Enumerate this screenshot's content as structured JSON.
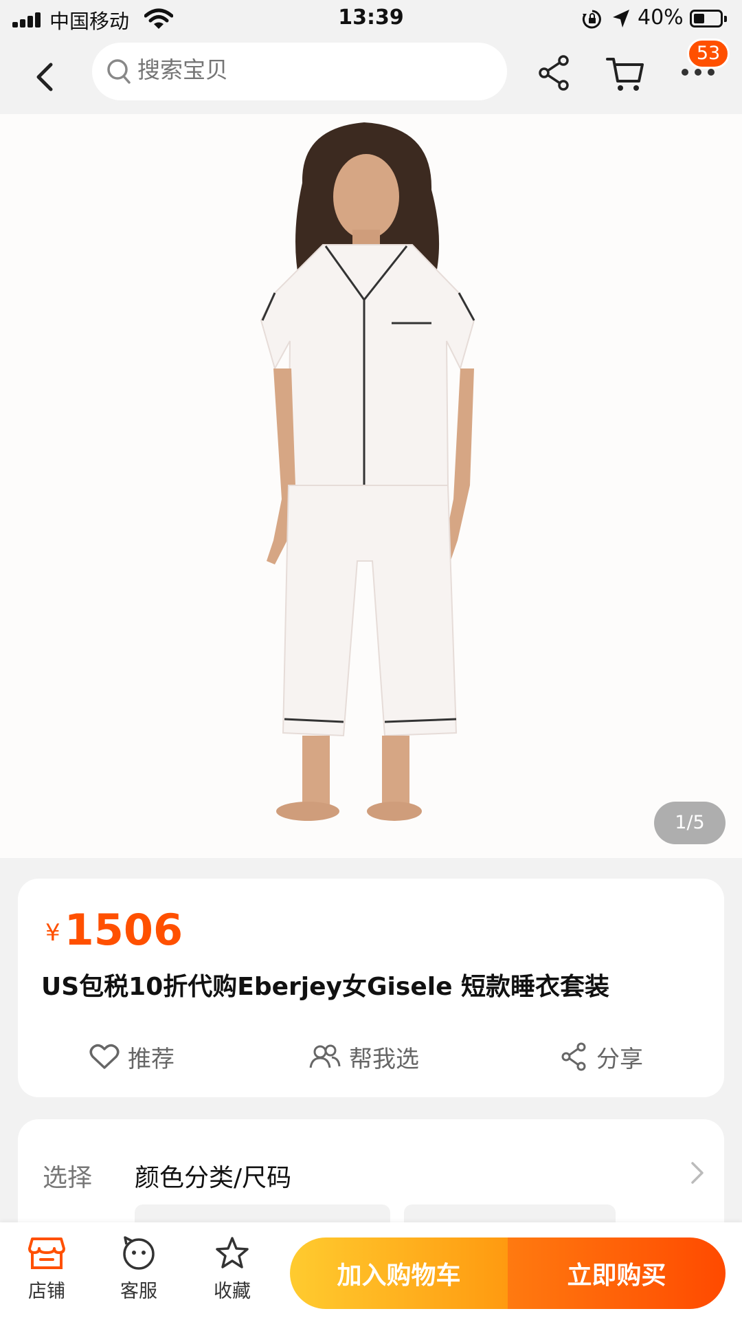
{
  "status_bar": {
    "carrier": "中国移动",
    "time": "13:39",
    "battery": "40%",
    "battery_level": 0.4
  },
  "search": {
    "placeholder": "搜索宝贝"
  },
  "header": {
    "badge_count": "53"
  },
  "gallery": {
    "counter": "1/5",
    "current": 1,
    "total": 5
  },
  "product": {
    "currency": "¥",
    "price": "1506",
    "title": "US包税10折代购Eberjey女Gisele 短款睡衣套装"
  },
  "actions": {
    "recommend": "推荐",
    "help_choose": "帮我选",
    "share": "分享"
  },
  "selection": {
    "label": "选择",
    "value": "颜色分类/尺码"
  },
  "bottom_bar": {
    "store": "店铺",
    "service": "客服",
    "favorite": "收藏",
    "add_to_cart": "加入购物车",
    "buy_now": "立即购买"
  },
  "colors": {
    "accent": "#ff5000",
    "cart_button": "#ffb01f",
    "buy_button": "#ff5a06"
  }
}
